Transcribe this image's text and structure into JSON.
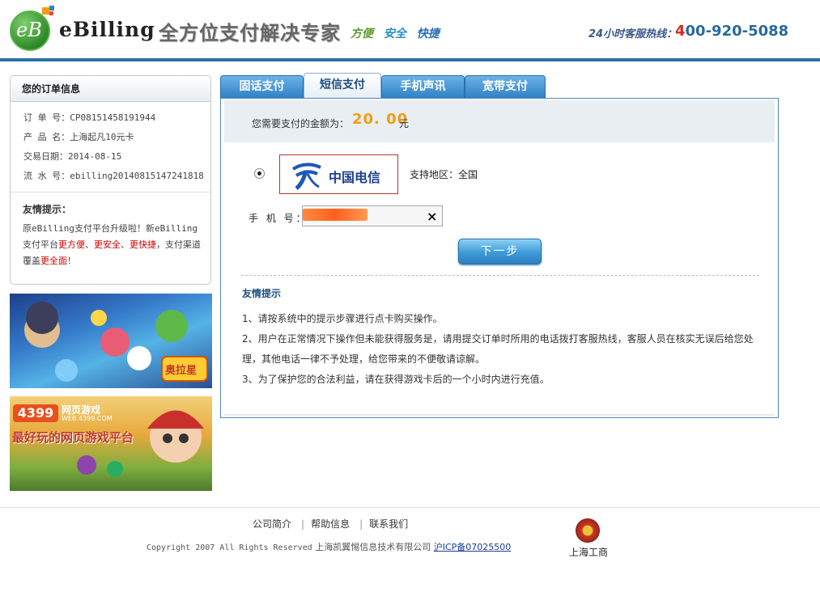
{
  "header": {
    "logo_text": "eB",
    "brand": "eBilling",
    "slogan": "全方位支付解决专家",
    "tags": [
      {
        "text": "方便",
        "color": "#5a9a2a"
      },
      {
        "text": "安全",
        "color": "#2a8fc6"
      },
      {
        "text": "快捷",
        "color": "#2a6fb5"
      }
    ],
    "hotline_label": "24小时客服热线：",
    "hotline_first": "4",
    "hotline_rest": "00-920-5088"
  },
  "order": {
    "title": "您的订单信息",
    "rows": [
      "订 单 号：CP08151458191944",
      "产 品 名：上海起凡10元卡",
      "交易日期：2014-08-15",
      "流 水 号：ebilling20140815147241818"
    ],
    "tips_title": "友情提示：",
    "tips_parts": {
      "p1": "原eBilling支付平台升级啦！新eBilling支付平台",
      "r1": "更方便",
      "s1": "、",
      "r2": "更安全",
      "s2": "、",
      "r3": "更快捷",
      "p2": "，支付渠道覆盖",
      "r4": "更全面",
      "p3": "！"
    }
  },
  "banners": {
    "banner1_logo": "奥拉星",
    "banner2_brand": "4399",
    "banner2_sub": "网页游戏",
    "banner2_url": "WEB.4399.COM",
    "banner2_text": "最好玩的网页游戏平台"
  },
  "tabs": [
    "固话支付",
    "短信支付",
    "手机声讯",
    "宽带支付"
  ],
  "payment": {
    "amount_label": "您需要支付的金额为：",
    "amount_value": "20. 00",
    "amount_unit": "元",
    "carrier_name": "中国电信",
    "region": "支持地区：全国",
    "phone_label": "手 机 号：",
    "clear_icon": "×",
    "next_button": "下一步"
  },
  "friendly_tips": {
    "title": "友情提示",
    "items": [
      "1、请按系统中的提示步骤进行点卡购买操作。",
      "2、用户在正常情况下操作但未能获得服务是，请用提交订单时所用的电话拨打客服热线，客服人员在核实无误后给您处理，其他电话一律不予处理，给您带来的不便敬请谅解。",
      "3、为了保护您的合法利益，请在获得游戏卡后的一个小时内进行充值。"
    ]
  },
  "footer": {
    "links": [
      "公司简介",
      "帮助信息",
      "联系我们"
    ],
    "copyright_en": "Copyright 2007 All Rights Reserved",
    "company": "上海凯翼惕信息技术有限公司",
    "icp": "沪ICP备07025500",
    "badge_label": "上海工商"
  }
}
